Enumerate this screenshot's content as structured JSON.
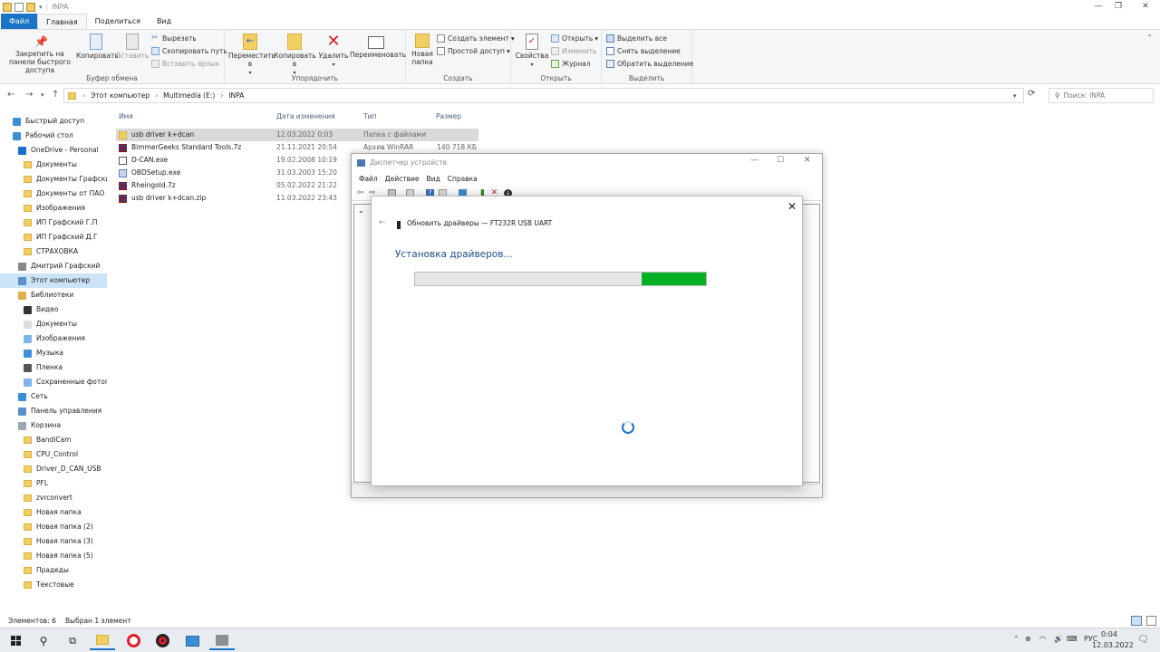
{
  "window": {
    "title": "INPA"
  },
  "ribbon": {
    "tabs": [
      "Файл",
      "Главная",
      "Поделиться",
      "Вид"
    ],
    "clipboard": {
      "pin": "Закрепить на панели быстрого доступа",
      "copy": "Копировать",
      "paste": "Вставить",
      "cut": "Вырезать",
      "copy_path": "Скопировать путь",
      "paste_shortcut": "Вставить ярлык",
      "label": "Буфер обмена"
    },
    "organize": {
      "move": "Переместить в",
      "copy_to": "Копировать в",
      "delete": "Удалить",
      "rename": "Переименовать",
      "label": "Упорядочить"
    },
    "create": {
      "new_folder": "Новая папка",
      "new_item": "Создать элемент",
      "easy_access": "Простой доступ",
      "label": "Создать"
    },
    "open": {
      "properties": "Свойства",
      "open": "Открыть",
      "edit": "Изменить",
      "history": "Журнал",
      "label": "Открыть"
    },
    "select": {
      "select_all": "Выделить все",
      "select_none": "Снять выделение",
      "invert": "Обратить выделение",
      "label": "Выделить"
    }
  },
  "address": {
    "crumbs": [
      "Этот компьютер",
      "Multimedia (E:)",
      "INPA"
    ],
    "search_placeholder": "Поиск: INPA"
  },
  "nav_pane": [
    {
      "label": "Быстрый доступ",
      "icon": "star-icon"
    },
    {
      "label": "Рабочий стол",
      "icon": "desktop-icon"
    },
    {
      "label": "OneDrive - Personal",
      "icon": "cloud-icon"
    },
    {
      "label": "Документы",
      "icon": "folder-icon"
    },
    {
      "label": "Документы Графский",
      "icon": "folder-icon"
    },
    {
      "label": "Документы от ПАО К",
      "icon": "folder-icon"
    },
    {
      "label": "Изображения",
      "icon": "folder-icon"
    },
    {
      "label": "ИП Графский Г.П",
      "icon": "folder-icon"
    },
    {
      "label": "ИП Графский Д.Г",
      "icon": "folder-icon"
    },
    {
      "label": "СТРАХОВКА",
      "icon": "folder-icon"
    },
    {
      "label": "Дмитрий Графский",
      "icon": "user-icon"
    },
    {
      "label": "Этот компьютер",
      "icon": "computer-icon"
    },
    {
      "label": "Библиотеки",
      "icon": "library-icon"
    },
    {
      "label": "Видео",
      "icon": "video-icon"
    },
    {
      "label": "Документы",
      "icon": "document-icon"
    },
    {
      "label": "Изображения",
      "icon": "image-icon"
    },
    {
      "label": "Музыка",
      "icon": "music-icon"
    },
    {
      "label": "Пленка",
      "icon": "film-icon"
    },
    {
      "label": "Сохраненные фотогр",
      "icon": "photo-icon"
    },
    {
      "label": "Сеть",
      "icon": "network-icon"
    },
    {
      "label": "Панель управления",
      "icon": "control-panel-icon"
    },
    {
      "label": "Корзина",
      "icon": "recycle-bin-icon"
    },
    {
      "label": "BandiCam",
      "icon": "folder-icon"
    },
    {
      "label": "CPU_Control",
      "icon": "folder-icon"
    },
    {
      "label": "Driver_D_CAN_USB",
      "icon": "folder-icon"
    },
    {
      "label": "PFL",
      "icon": "folder-icon"
    },
    {
      "label": "zvrconvert",
      "icon": "folder-icon"
    },
    {
      "label": "Новая папка",
      "icon": "folder-icon"
    },
    {
      "label": "Новая папка (2)",
      "icon": "folder-icon"
    },
    {
      "label": "Новая папка (3)",
      "icon": "folder-icon"
    },
    {
      "label": "Новая папка (5)",
      "icon": "folder-icon"
    },
    {
      "label": "Прадеды",
      "icon": "folder-icon"
    },
    {
      "label": "Текстовые",
      "icon": "folder-icon"
    }
  ],
  "file_list": {
    "columns": [
      "Имя",
      "Дата изменения",
      "Тип",
      "Размер"
    ],
    "rows": [
      {
        "name": "usb driver k+dcan",
        "date": "12.03.2022 0:03",
        "type": "Папка с файлами",
        "size": "",
        "icon": "folder-icon"
      },
      {
        "name": "BimmerGeeks Standard Tools.7z",
        "date": "21.11.2021 20:54",
        "type": "Архив WinRAR",
        "size": "140 718 КБ",
        "icon": "archive-icon"
      },
      {
        "name": "D-CAN.exe",
        "date": "19.02.2008 10:19",
        "type": "",
        "size": "",
        "icon": "exe-icon"
      },
      {
        "name": "OBDSetup.exe",
        "date": "31.03.2003 15:20",
        "type": "",
        "size": "",
        "icon": "setup-icon"
      },
      {
        "name": "Rheingold.7z",
        "date": "05.02.2022 21:22",
        "type": "",
        "size": "",
        "icon": "archive-icon"
      },
      {
        "name": "usb driver k+dcan.zip",
        "date": "11.03.2022 23:43",
        "type": "",
        "size": "",
        "icon": "archive-icon"
      }
    ]
  },
  "status": {
    "items": "Элементов: 6",
    "selected": "Выбран 1 элемент"
  },
  "device_manager": {
    "title": "Диспетчер устройств",
    "menu": [
      "Файл",
      "Действие",
      "Вид",
      "Справка"
    ]
  },
  "update_dialog": {
    "header": "Обновить драйверы — FT232R USB UART",
    "status_text": "Установка драйверов...",
    "progress_start": 0.78,
    "progress_end": 1.0
  },
  "taskbar": {
    "lang": "РУС",
    "time": "0:04",
    "date": "12.03.2022"
  }
}
